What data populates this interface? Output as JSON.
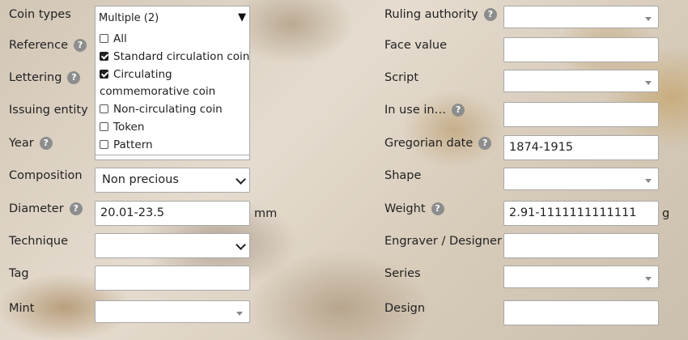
{
  "left": {
    "coin_types": {
      "label": "Coin types",
      "selected": "Multiple (2)",
      "options": [
        {
          "label": "All",
          "checked": false
        },
        {
          "label": "Standard circulation coin",
          "checked": true
        },
        {
          "label": "Circulating",
          "checked": true
        },
        {
          "label": "commemorative coin",
          "checked": true
        },
        {
          "label": "Non-circulating coin",
          "checked": false
        },
        {
          "label": "Token",
          "checked": false
        },
        {
          "label": "Pattern",
          "checked": false
        }
      ]
    },
    "reference_label": "Reference",
    "lettering_label": "Lettering",
    "issuing_entity_label": "Issuing entity",
    "year_label": "Year",
    "composition": {
      "label": "Composition",
      "value": "Non precious"
    },
    "diameter": {
      "label": "Diameter",
      "value": "20.01-23.5",
      "unit": "mm"
    },
    "technique": {
      "label": "Technique",
      "value": ""
    },
    "tag": {
      "label": "Tag",
      "value": ""
    },
    "mint": {
      "label": "Mint",
      "value": ""
    }
  },
  "right": {
    "ruling_authority": {
      "label": "Ruling authority",
      "value": ""
    },
    "face_value": {
      "label": "Face value",
      "value": ""
    },
    "script": {
      "label": "Script",
      "value": ""
    },
    "in_use_in": {
      "label": "In use in…",
      "value": ""
    },
    "gregorian_date": {
      "label": "Gregorian date",
      "value": "1874-1915"
    },
    "shape": {
      "label": "Shape",
      "value": ""
    },
    "weight": {
      "label": "Weight",
      "value": "2.91-1111111111111",
      "unit": "g"
    },
    "engraver": {
      "label": "Engraver / Designer",
      "value": ""
    },
    "series": {
      "label": "Series",
      "value": ""
    },
    "design": {
      "label": "Design",
      "value": ""
    }
  },
  "help_glyph": "?"
}
